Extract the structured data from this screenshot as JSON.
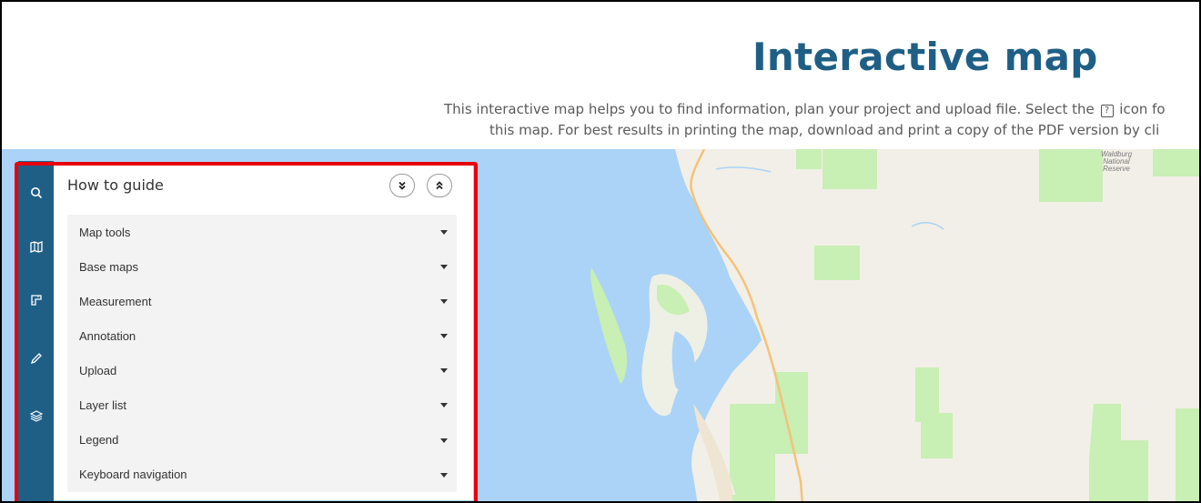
{
  "header": {
    "title": "Interactive map",
    "description_line1_a": "This interactive map helps you to find information, plan your project and upload file. Select the",
    "description_line1_b": "icon fo",
    "description_line2": "this map. For best results in printing the map, download and print a copy of the PDF version by cli",
    "help_icon_glyph": "?"
  },
  "sidebar": {
    "items": [
      {
        "name": "search",
        "icon": "search-icon"
      },
      {
        "name": "basemap",
        "icon": "map-icon"
      },
      {
        "name": "measure",
        "icon": "ruler-icon"
      },
      {
        "name": "draw",
        "icon": "pencil-icon"
      },
      {
        "name": "layers",
        "icon": "layers-icon"
      }
    ]
  },
  "panel": {
    "title": "How to guide",
    "expand_all_icon": "double-chevron-down-icon",
    "collapse_all_icon": "double-chevron-up-icon",
    "items": [
      {
        "label": "Map tools"
      },
      {
        "label": "Base maps"
      },
      {
        "label": "Measurement"
      },
      {
        "label": "Annotation"
      },
      {
        "label": "Upload"
      },
      {
        "label": "Layer list"
      },
      {
        "label": "Legend"
      },
      {
        "label": "Keyboard navigation"
      }
    ]
  },
  "map": {
    "labels": {
      "reserve_line1": "Waldburg",
      "reserve_line2": "National",
      "reserve_line3": "Reserve"
    }
  },
  "colors": {
    "brand": "#1f5f86",
    "water": "#aad3f7",
    "land": "#f2efe8",
    "park": "#c8efb4",
    "road": "#f4c27a",
    "highlight": "#e8000c"
  }
}
